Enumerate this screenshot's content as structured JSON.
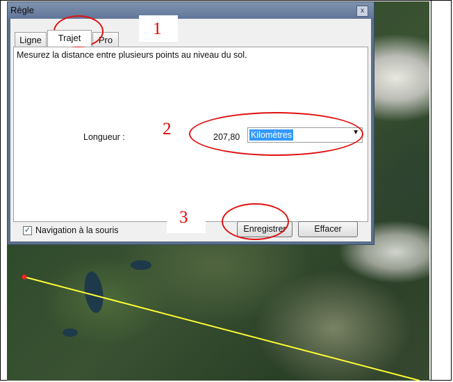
{
  "dialog": {
    "title": "Règle",
    "close_glyph": "x",
    "tabs": [
      {
        "label": "Ligne",
        "active": false
      },
      {
        "label": "Trajet",
        "active": true
      },
      {
        "label": "Pro",
        "active": false
      }
    ],
    "description": "Mesurez la distance entre plusieurs points au niveau du sol.",
    "length_label": "Longueur :",
    "length_value": "207,80",
    "unit_selected": "Kilomètres",
    "mouse_nav_label": "Navigation à la souris",
    "mouse_nav_checked": true,
    "save_label": "Enregistrer",
    "clear_label": "Effacer"
  },
  "annotations": {
    "n1": "1",
    "n2": "2",
    "n3": "3",
    "color": "#e10000"
  },
  "map": {
    "path_color": "#ffff33",
    "start_marker_color": "#ff2020"
  }
}
